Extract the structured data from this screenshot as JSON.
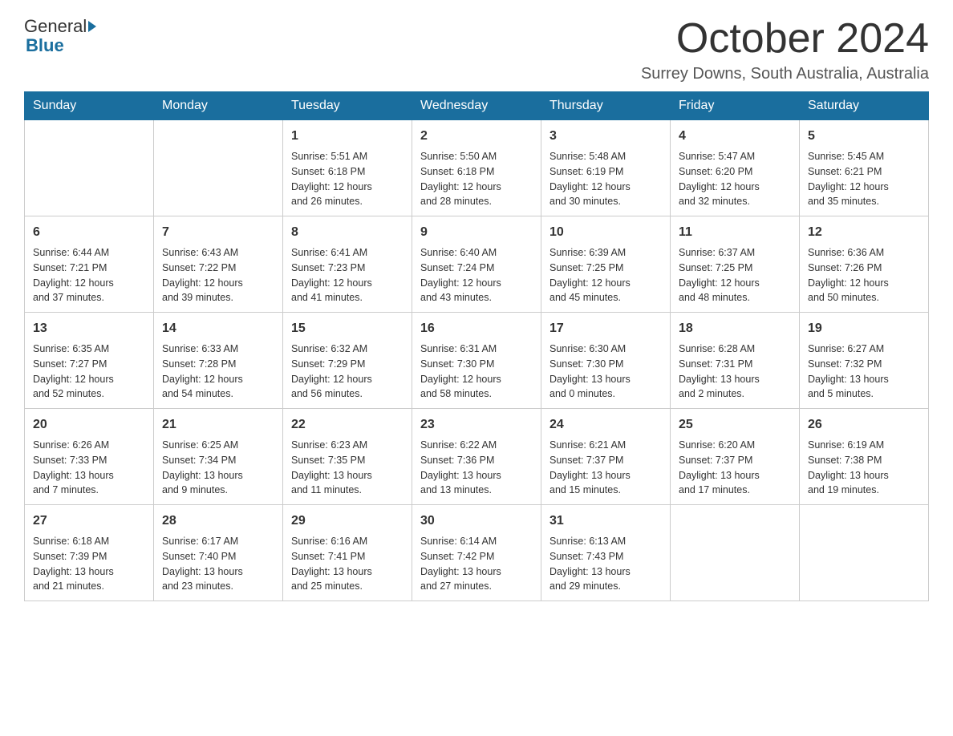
{
  "header": {
    "logo_general": "General",
    "logo_blue": "Blue",
    "month_title": "October 2024",
    "location": "Surrey Downs, South Australia, Australia"
  },
  "weekdays": [
    "Sunday",
    "Monday",
    "Tuesday",
    "Wednesday",
    "Thursday",
    "Friday",
    "Saturday"
  ],
  "weeks": [
    [
      {
        "day": "",
        "info": ""
      },
      {
        "day": "",
        "info": ""
      },
      {
        "day": "1",
        "info": "Sunrise: 5:51 AM\nSunset: 6:18 PM\nDaylight: 12 hours\nand 26 minutes."
      },
      {
        "day": "2",
        "info": "Sunrise: 5:50 AM\nSunset: 6:18 PM\nDaylight: 12 hours\nand 28 minutes."
      },
      {
        "day": "3",
        "info": "Sunrise: 5:48 AM\nSunset: 6:19 PM\nDaylight: 12 hours\nand 30 minutes."
      },
      {
        "day": "4",
        "info": "Sunrise: 5:47 AM\nSunset: 6:20 PM\nDaylight: 12 hours\nand 32 minutes."
      },
      {
        "day": "5",
        "info": "Sunrise: 5:45 AM\nSunset: 6:21 PM\nDaylight: 12 hours\nand 35 minutes."
      }
    ],
    [
      {
        "day": "6",
        "info": "Sunrise: 6:44 AM\nSunset: 7:21 PM\nDaylight: 12 hours\nand 37 minutes."
      },
      {
        "day": "7",
        "info": "Sunrise: 6:43 AM\nSunset: 7:22 PM\nDaylight: 12 hours\nand 39 minutes."
      },
      {
        "day": "8",
        "info": "Sunrise: 6:41 AM\nSunset: 7:23 PM\nDaylight: 12 hours\nand 41 minutes."
      },
      {
        "day": "9",
        "info": "Sunrise: 6:40 AM\nSunset: 7:24 PM\nDaylight: 12 hours\nand 43 minutes."
      },
      {
        "day": "10",
        "info": "Sunrise: 6:39 AM\nSunset: 7:25 PM\nDaylight: 12 hours\nand 45 minutes."
      },
      {
        "day": "11",
        "info": "Sunrise: 6:37 AM\nSunset: 7:25 PM\nDaylight: 12 hours\nand 48 minutes."
      },
      {
        "day": "12",
        "info": "Sunrise: 6:36 AM\nSunset: 7:26 PM\nDaylight: 12 hours\nand 50 minutes."
      }
    ],
    [
      {
        "day": "13",
        "info": "Sunrise: 6:35 AM\nSunset: 7:27 PM\nDaylight: 12 hours\nand 52 minutes."
      },
      {
        "day": "14",
        "info": "Sunrise: 6:33 AM\nSunset: 7:28 PM\nDaylight: 12 hours\nand 54 minutes."
      },
      {
        "day": "15",
        "info": "Sunrise: 6:32 AM\nSunset: 7:29 PM\nDaylight: 12 hours\nand 56 minutes."
      },
      {
        "day": "16",
        "info": "Sunrise: 6:31 AM\nSunset: 7:30 PM\nDaylight: 12 hours\nand 58 minutes."
      },
      {
        "day": "17",
        "info": "Sunrise: 6:30 AM\nSunset: 7:30 PM\nDaylight: 13 hours\nand 0 minutes."
      },
      {
        "day": "18",
        "info": "Sunrise: 6:28 AM\nSunset: 7:31 PM\nDaylight: 13 hours\nand 2 minutes."
      },
      {
        "day": "19",
        "info": "Sunrise: 6:27 AM\nSunset: 7:32 PM\nDaylight: 13 hours\nand 5 minutes."
      }
    ],
    [
      {
        "day": "20",
        "info": "Sunrise: 6:26 AM\nSunset: 7:33 PM\nDaylight: 13 hours\nand 7 minutes."
      },
      {
        "day": "21",
        "info": "Sunrise: 6:25 AM\nSunset: 7:34 PM\nDaylight: 13 hours\nand 9 minutes."
      },
      {
        "day": "22",
        "info": "Sunrise: 6:23 AM\nSunset: 7:35 PM\nDaylight: 13 hours\nand 11 minutes."
      },
      {
        "day": "23",
        "info": "Sunrise: 6:22 AM\nSunset: 7:36 PM\nDaylight: 13 hours\nand 13 minutes."
      },
      {
        "day": "24",
        "info": "Sunrise: 6:21 AM\nSunset: 7:37 PM\nDaylight: 13 hours\nand 15 minutes."
      },
      {
        "day": "25",
        "info": "Sunrise: 6:20 AM\nSunset: 7:37 PM\nDaylight: 13 hours\nand 17 minutes."
      },
      {
        "day": "26",
        "info": "Sunrise: 6:19 AM\nSunset: 7:38 PM\nDaylight: 13 hours\nand 19 minutes."
      }
    ],
    [
      {
        "day": "27",
        "info": "Sunrise: 6:18 AM\nSunset: 7:39 PM\nDaylight: 13 hours\nand 21 minutes."
      },
      {
        "day": "28",
        "info": "Sunrise: 6:17 AM\nSunset: 7:40 PM\nDaylight: 13 hours\nand 23 minutes."
      },
      {
        "day": "29",
        "info": "Sunrise: 6:16 AM\nSunset: 7:41 PM\nDaylight: 13 hours\nand 25 minutes."
      },
      {
        "day": "30",
        "info": "Sunrise: 6:14 AM\nSunset: 7:42 PM\nDaylight: 13 hours\nand 27 minutes."
      },
      {
        "day": "31",
        "info": "Sunrise: 6:13 AM\nSunset: 7:43 PM\nDaylight: 13 hours\nand 29 minutes."
      },
      {
        "day": "",
        "info": ""
      },
      {
        "day": "",
        "info": ""
      }
    ]
  ]
}
